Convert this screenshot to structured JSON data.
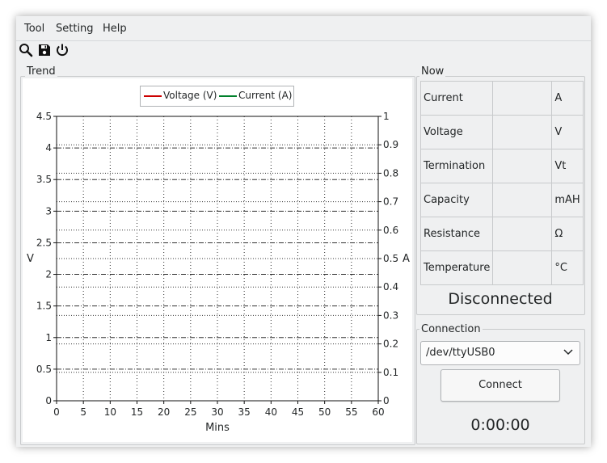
{
  "menu": {
    "items": [
      "Tool",
      "Setting",
      "Help"
    ]
  },
  "toolbar": {
    "icons": [
      "search-icon",
      "save-icon",
      "power-icon"
    ]
  },
  "trend": {
    "group_title": "Trend",
    "legend": [
      {
        "label": "Voltage (V)",
        "color": "#cc0000"
      },
      {
        "label": "Current (A)",
        "color": "#00802b"
      }
    ]
  },
  "chart_data": {
    "type": "line",
    "xlabel": "Mins",
    "ylabel": "V",
    "y2label": "A",
    "xlim": [
      0,
      60
    ],
    "ylim": [
      0,
      4.5
    ],
    "y2lim": [
      0,
      1
    ],
    "x_ticks": [
      "0",
      "5",
      "10",
      "15",
      "20",
      "25",
      "30",
      "35",
      "40",
      "45",
      "50",
      "55",
      "60"
    ],
    "y_ticks": [
      "0",
      "0.5",
      "1",
      "1.5",
      "2",
      "2.5",
      "3",
      "3.5",
      "4",
      "4.5"
    ],
    "y2_ticks": [
      "0",
      "0.1",
      "0.2",
      "0.3",
      "0.4",
      "0.5",
      "0.6",
      "0.7",
      "0.8",
      "0.9",
      "1"
    ],
    "grid": true,
    "legend_position": "top-center",
    "series": [
      {
        "name": "Voltage (V)",
        "values": []
      },
      {
        "name": "Current (A)",
        "values": []
      }
    ]
  },
  "now": {
    "group_title": "Now",
    "rows": [
      {
        "label": "Current",
        "value": "",
        "unit": "A"
      },
      {
        "label": "Voltage",
        "value": "",
        "unit": "V"
      },
      {
        "label": "Termination",
        "value": "",
        "unit": "Vt"
      },
      {
        "label": "Capacity",
        "value": "",
        "unit": "mAH"
      },
      {
        "label": "Resistance",
        "value": "",
        "unit": "Ω"
      },
      {
        "label": "Temperature",
        "value": "",
        "unit": "°C"
      }
    ],
    "status": "Disconnected"
  },
  "connection": {
    "group_title": "Connection",
    "port": "/dev/ttyUSB0",
    "connect_label": "Connect",
    "timer": "0:00:00"
  }
}
